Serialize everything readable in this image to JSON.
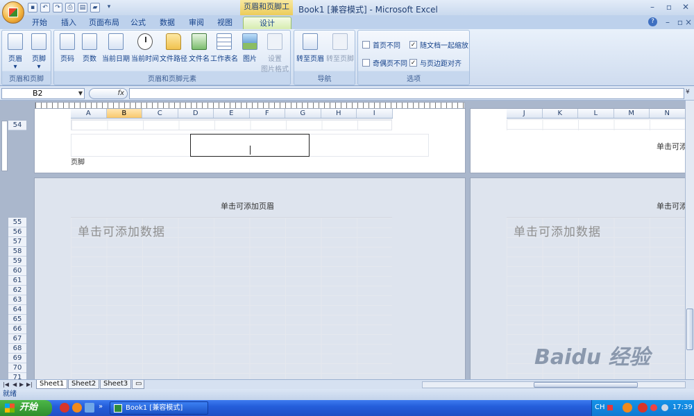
{
  "window": {
    "title": "Book1  [兼容模式] - Microsoft Excel",
    "context_tab": "页眉和页脚工具"
  },
  "tabs": [
    "开始",
    "插入",
    "页面布局",
    "公式",
    "数据",
    "审阅",
    "视图",
    "设计"
  ],
  "ribbon": {
    "group1": {
      "label": "页眉和页脚",
      "buttons": [
        "页眉",
        "页脚"
      ]
    },
    "group2": {
      "label": "页眉和页脚元素",
      "buttons": [
        "页码",
        "页数",
        "当前日期",
        "当前时间",
        "文件路径",
        "文件名",
        "工作表名",
        "图片"
      ],
      "disabled": {
        "line1": "设置",
        "line2": "图片格式"
      }
    },
    "group3": {
      "label": "导航",
      "buttons": [
        "转至页眉",
        "转至页脚"
      ]
    },
    "group4": {
      "label": "选项",
      "options": [
        {
          "label": "首页不同",
          "checked": false
        },
        {
          "label": "随文档一起缩放",
          "checked": true
        },
        {
          "label": "奇偶页不同",
          "checked": false
        },
        {
          "label": "与页边距对齐",
          "checked": true
        }
      ]
    }
  },
  "formula": {
    "name_box": "B2",
    "fx": "fx",
    "value": ""
  },
  "columns_left": [
    "A",
    "B",
    "C",
    "D",
    "E",
    "F",
    "G",
    "H",
    "I"
  ],
  "columns_right": [
    "J",
    "K",
    "L",
    "M",
    "N"
  ],
  "row_top": "54",
  "rows": [
    "55",
    "56",
    "57",
    "58",
    "59",
    "60",
    "61",
    "62",
    "63",
    "64",
    "65",
    "66",
    "67",
    "68",
    "69",
    "70",
    "71"
  ],
  "page": {
    "footer_label": "页脚",
    "header_hint": "单击可添加页眉",
    "data_hint": "单击可添加数据",
    "right_hint": "单击可添"
  },
  "sheets": [
    "Sheet1",
    "Sheet2",
    "Sheet3"
  ],
  "status": "就绪",
  "taskbar": {
    "start": "开始",
    "task": "Book1  [兼容模式]",
    "ime": "CH",
    "clock": "17:39"
  },
  "watermark": "Baidu 经验"
}
